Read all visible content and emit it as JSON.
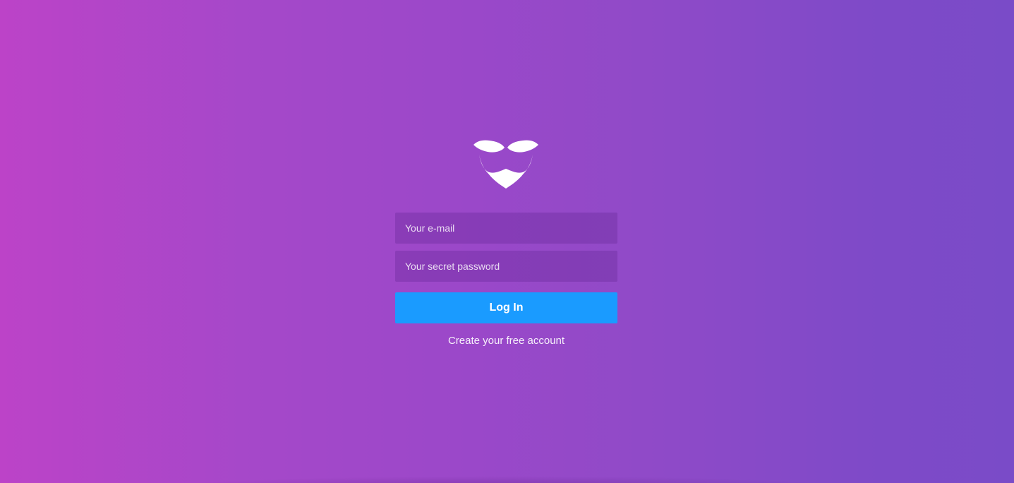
{
  "logo": {
    "icon": "mustache-beard-icon",
    "color": "#ffffff"
  },
  "login_form": {
    "email_placeholder": "Your e-mail",
    "email_value": "",
    "password_placeholder": "Your secret password",
    "password_value": "",
    "login_label": "Log In",
    "signup_label": "Create your free account"
  },
  "colors": {
    "background_left": "#bc43c8",
    "background_right": "#7a4bc8",
    "button": "#1a9bff"
  }
}
